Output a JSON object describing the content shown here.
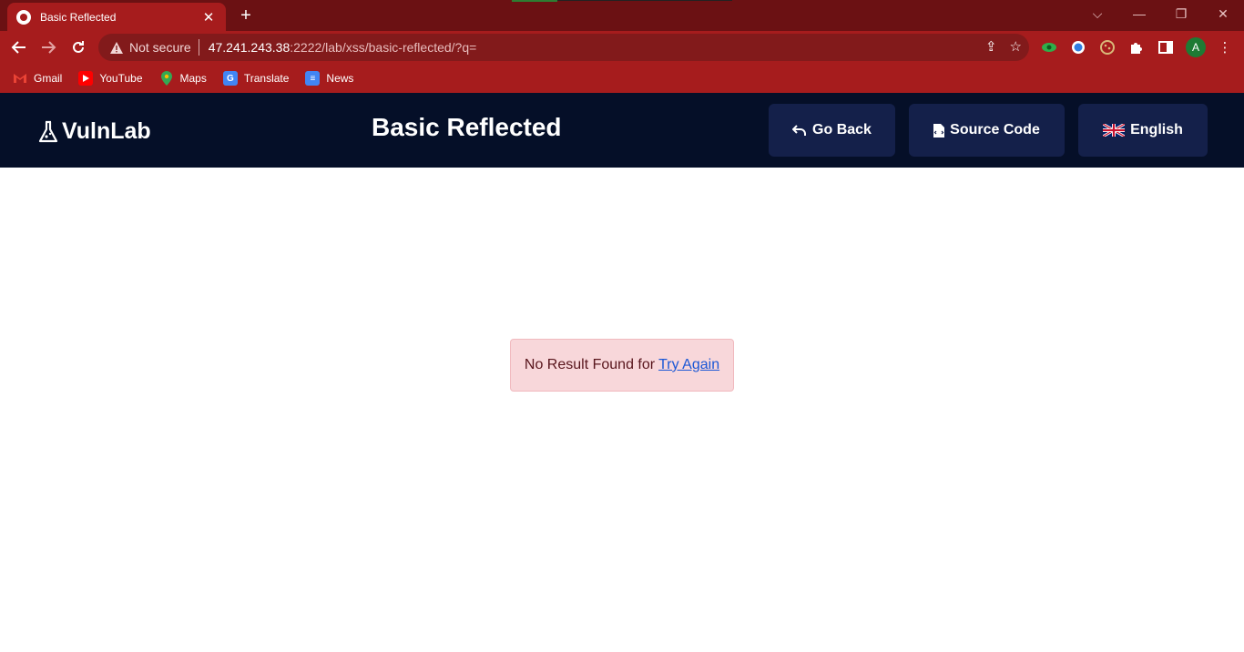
{
  "browser": {
    "tab": {
      "title": "Basic Reflected"
    },
    "address": {
      "security_label": "Not secure",
      "host": "47.241.243.38",
      "rest": ":2222/lab/xss/basic-reflected/?q="
    },
    "profile_initial": "A",
    "bookmarks": [
      {
        "label": "Gmail",
        "icon": "gmail-icon",
        "color": "#ea4335"
      },
      {
        "label": "YouTube",
        "icon": "youtube-icon",
        "color": "#ff0000"
      },
      {
        "label": "Maps",
        "icon": "maps-icon",
        "color": "#34a853"
      },
      {
        "label": "Translate",
        "icon": "translate-icon",
        "color": "#4285f4"
      },
      {
        "label": "News",
        "icon": "news-icon",
        "color": "#4285f4"
      }
    ]
  },
  "page": {
    "brand": "VulnLab",
    "title": "Basic Reflected",
    "buttons": {
      "go_back": "Go Back",
      "source_code": "Source Code",
      "language": "English"
    },
    "alert": {
      "message": "No Result Found for",
      "link": "Try Again"
    }
  },
  "colors": {
    "header_bg": "#050f28",
    "button_bg": "#14204a",
    "browser_frame": "#a61c1d",
    "alert_bg": "#f8d7da",
    "link": "#1a57d6"
  }
}
